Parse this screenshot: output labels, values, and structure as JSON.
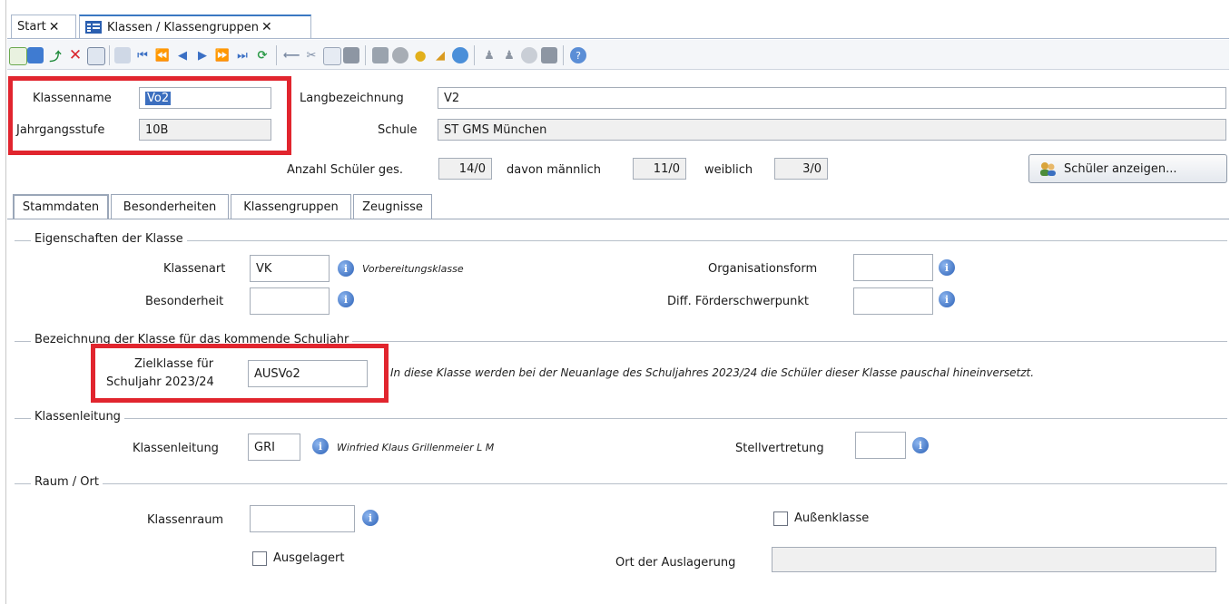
{
  "tabs": [
    {
      "label": "Start",
      "close": "✕"
    },
    {
      "label": "Klassen / Klassengruppen",
      "close": "✕"
    }
  ],
  "toolbar_icons": [
    "new-icon",
    "save-icon",
    "undo-icon",
    "delete-icon",
    "list-icon",
    "grid-icon",
    "first-icon",
    "fast-back-icon",
    "prev-icon",
    "next-icon",
    "fast-forward-icon",
    "last-icon",
    "refresh-icon",
    "back-arrow-icon",
    "cut-icon",
    "copy-icon",
    "paste-icon",
    "print-icon",
    "cloud-icon",
    "lightbulb-icon",
    "broom-icon",
    "clock-icon",
    "user-group-icon",
    "user-group-2-icon",
    "badge-icon",
    "book-icon",
    "help-icon"
  ],
  "header": {
    "klassenname_label": "Klassenname",
    "klassenname_value": "Vo2",
    "jahrgang_label": "Jahrgangsstufe",
    "jahrgang_value": "10B",
    "lang_label": "Langbezeichnung",
    "lang_value": "V2",
    "schule_label": "Schule",
    "schule_value": "ST GMS München",
    "anzahl_label": "Anzahl Schüler ges.",
    "anzahl_value": "14/0",
    "maennlich_label": "davon männlich",
    "maennlich_value": "11/0",
    "weiblich_label": "weiblich",
    "weiblich_value": "3/0",
    "show_button": "Schüler anzeigen..."
  },
  "subtabs": [
    "Stammdaten",
    "Besonderheiten",
    "Klassengruppen",
    "Zeugnisse"
  ],
  "eigenschaften": {
    "title": "Eigenschaften der Klasse",
    "klassenart_label": "Klassenart",
    "klassenart_value": "VK",
    "klassenart_desc": "Vorbereitungsklasse",
    "besonderheit_label": "Besonderheit",
    "besonderheit_value": "",
    "organisationsform_label": "Organisationsform",
    "organisationsform_value": "",
    "foerder_label": "Diff. Förderschwerpunkt",
    "foerder_value": ""
  },
  "kommend": {
    "title": "Bezeichnung der Klasse für das kommende Schuljahr",
    "ziel_label_1": "Zielklasse für",
    "ziel_label_2": "Schuljahr 2023/24",
    "ziel_value": "AUSVo2",
    "note": "In diese Klasse werden bei der Neuanlage des Schuljahres 2023/24 die Schüler dieser Klasse pauschal hineinversetzt."
  },
  "leitung": {
    "title": "Klassenleitung",
    "label": "Klassenleitung",
    "value": "GRI",
    "name": "Winfried Klaus Grillenmeier L M",
    "stellv_label": "Stellvertretung",
    "stellv_value": ""
  },
  "raum": {
    "title": "Raum / Ort",
    "klassenraum_label": "Klassenraum",
    "klassenraum_value": "",
    "aussen_label": "Außenklasse",
    "ausgelagert_label": "Ausgelagert",
    "ort_label": "Ort der Auslagerung",
    "ort_value": ""
  },
  "colors": {
    "highlight": "#e1252e",
    "selection": "#3c6fbf",
    "info": "#2b60b6"
  }
}
